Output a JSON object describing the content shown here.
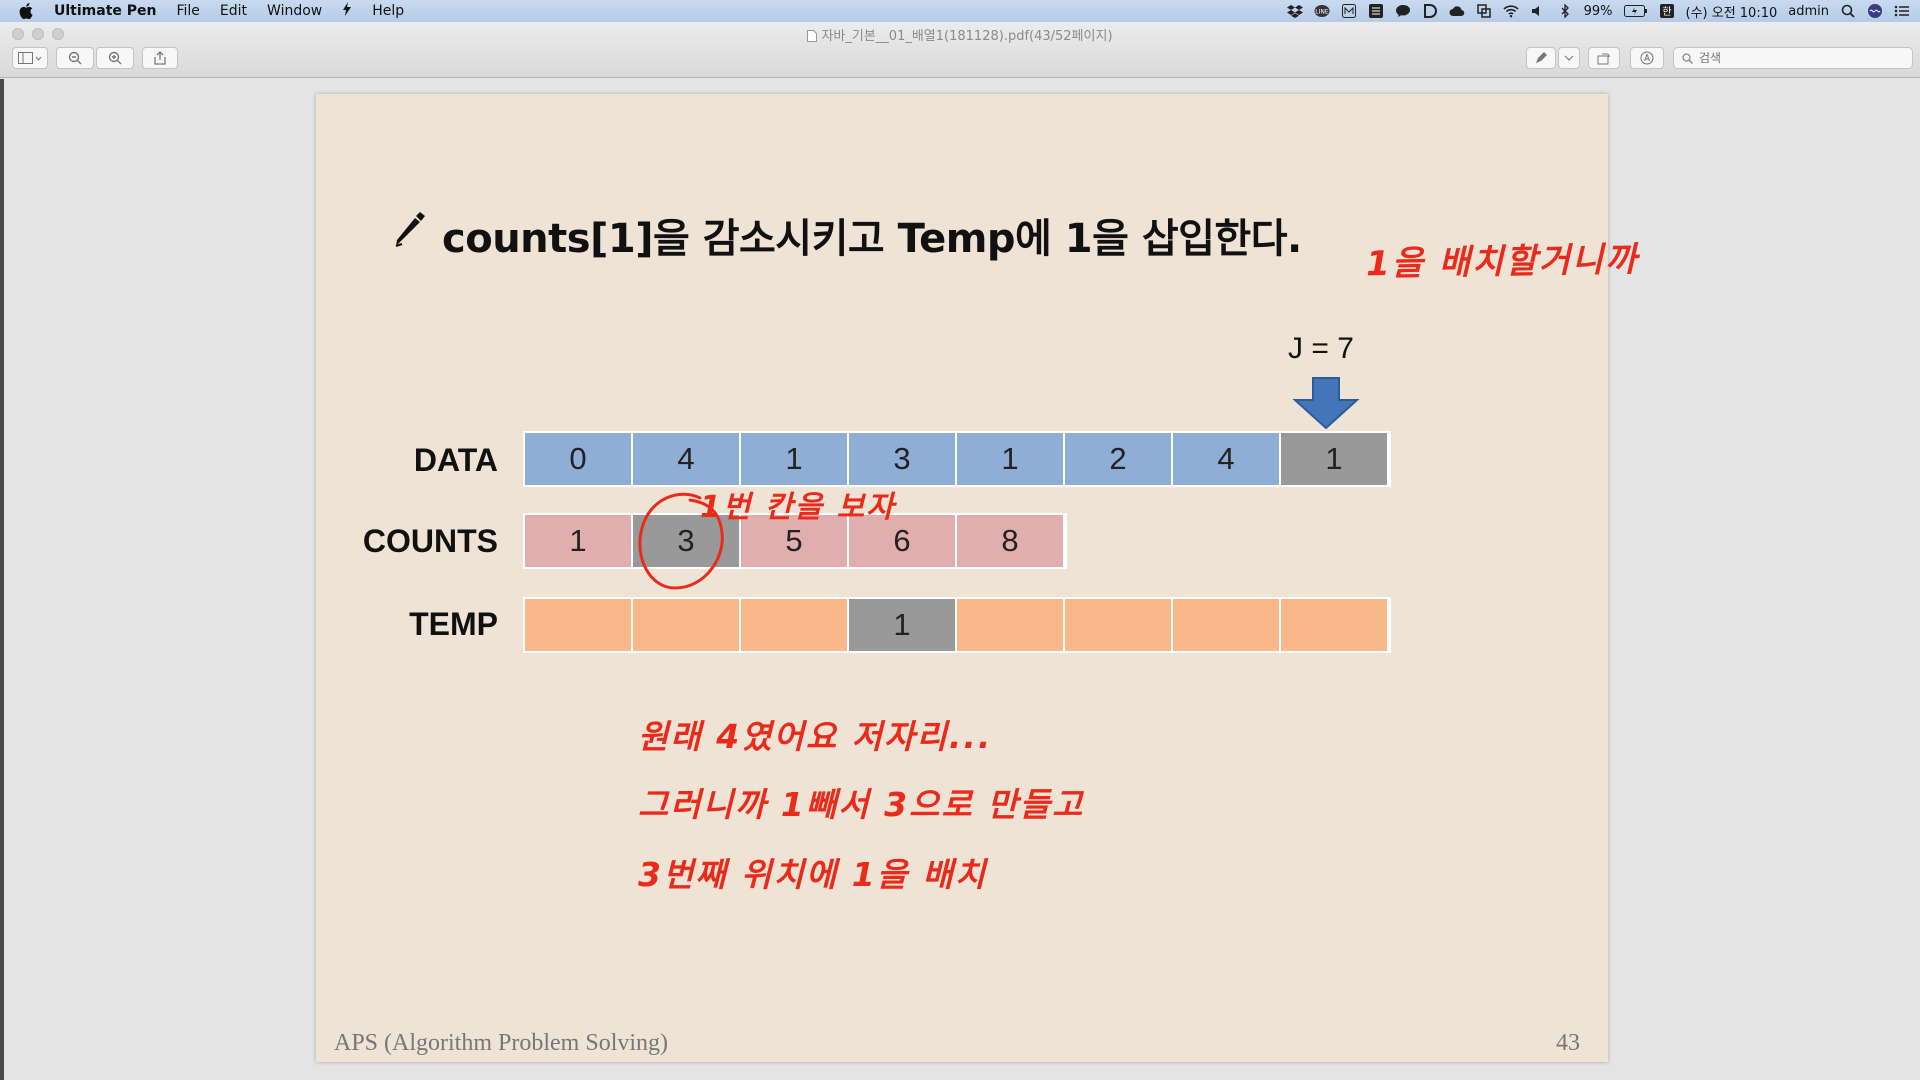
{
  "menubar": {
    "app_name": "Ultimate Pen",
    "menus": [
      "File",
      "Edit",
      "Window",
      "Help"
    ],
    "status": {
      "battery": "99%",
      "datetime": "(수) 오전 10:10",
      "user": "admin"
    }
  },
  "window": {
    "title": "자바_기본__01_배열1(181128).pdf(43/52페이지)",
    "search_placeholder": "검색"
  },
  "slide": {
    "title": "counts[1]을 감소시키고 Temp에 1을 삽입한다.",
    "j_label": "J = 7",
    "rows": {
      "data": {
        "label": "DATA",
        "values": [
          "0",
          "4",
          "1",
          "3",
          "1",
          "2",
          "4",
          "1"
        ],
        "highlight_index": 7
      },
      "counts": {
        "label": "COUNTS",
        "values": [
          "1",
          "3",
          "5",
          "6",
          "8"
        ],
        "highlight_index": 1
      },
      "temp": {
        "label": "TEMP",
        "values": [
          "",
          "",
          "",
          "1",
          "",
          "",
          "",
          ""
        ],
        "highlight_index": 3
      }
    },
    "footer_left": "APS (Algorithm Problem Solving)",
    "page_number": "43"
  },
  "annotations": {
    "top_right": "1을 배치할거니까",
    "counts_note": "1번 칸을 보자",
    "line1": "원래 4였어요 저자리...",
    "line2": "그러니까 1빼서 3으로 만들고",
    "line3": "3번째 위치에 1을 배치"
  },
  "colors": {
    "data_cell": "#8eaed6",
    "counts_cell": "#e0aeae",
    "temp_cell": "#f9b88a",
    "highlight_cell": "#999999",
    "ink": "#ea2a1a",
    "arrow": "#4475b8"
  }
}
